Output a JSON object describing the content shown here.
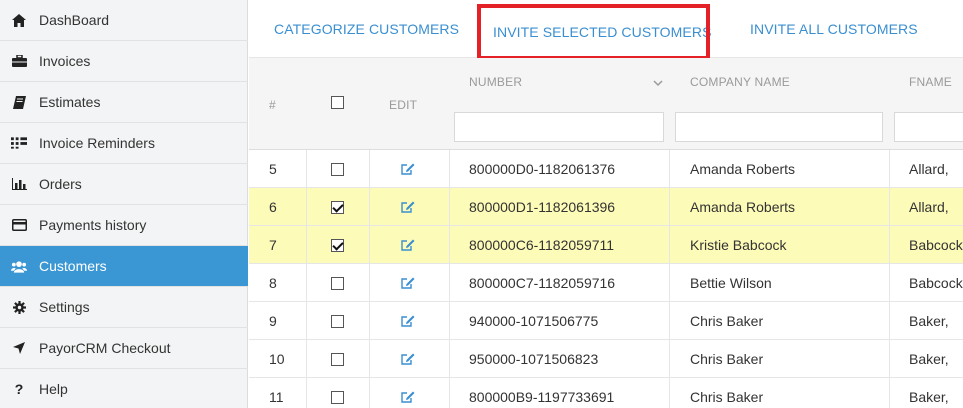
{
  "sidebar": {
    "items": [
      {
        "label": "DashBoard",
        "icon": "home-icon",
        "active": false
      },
      {
        "label": "Invoices",
        "icon": "briefcase-icon",
        "active": false
      },
      {
        "label": "Estimates",
        "icon": "book-icon",
        "active": false
      },
      {
        "label": "Invoice Reminders",
        "icon": "grid-list-icon",
        "active": false
      },
      {
        "label": "Orders",
        "icon": "bar-chart-icon",
        "active": false
      },
      {
        "label": "Payments history",
        "icon": "credit-card-icon",
        "active": false
      },
      {
        "label": "Customers",
        "icon": "users-icon",
        "active": true
      },
      {
        "label": "Settings",
        "icon": "gear-icon",
        "active": false
      },
      {
        "label": "PayorCRM Checkout",
        "icon": "location-arrow-icon",
        "active": false
      },
      {
        "label": "Help",
        "icon": "question-icon",
        "active": false
      }
    ]
  },
  "toolbar": {
    "categorize_label": "CATEGORIZE CUSTOMERS",
    "invite_selected_label": "INVITE SELECTED CUSTOMERS",
    "invite_all_label": "INVITE ALL CUSTOMERS"
  },
  "table": {
    "headers": {
      "index": "#",
      "edit": "EDIT",
      "number": "NUMBER",
      "company": "COMPANY NAME",
      "fname": "FNAME"
    },
    "rows": [
      {
        "index": "5",
        "checked": false,
        "number": "800000D0-1182061376",
        "company": "Amanda Roberts",
        "fname": "Allard,"
      },
      {
        "index": "6",
        "checked": true,
        "number": "800000D1-1182061396",
        "company": "Amanda Roberts",
        "fname": "Allard,"
      },
      {
        "index": "7",
        "checked": true,
        "number": "800000C6-1182059711",
        "company": "Kristie Babcock",
        "fname": "Babcock"
      },
      {
        "index": "8",
        "checked": false,
        "number": "800000C7-1182059716",
        "company": "Bettie Wilson",
        "fname": "Babcock"
      },
      {
        "index": "9",
        "checked": false,
        "number": "940000-1071506775",
        "company": "Chris Baker",
        "fname": "Baker,"
      },
      {
        "index": "10",
        "checked": false,
        "number": "950000-1071506823",
        "company": "Chris Baker",
        "fname": "Baker,"
      },
      {
        "index": "11",
        "checked": false,
        "number": "800000B9-1197733691",
        "company": "Chris Baker",
        "fname": "Baker,"
      }
    ]
  },
  "colors": {
    "accent": "#3a97d4",
    "link": "#3a8fd1",
    "selected_row": "#fdfbb8",
    "highlight_border": "#e32126"
  }
}
